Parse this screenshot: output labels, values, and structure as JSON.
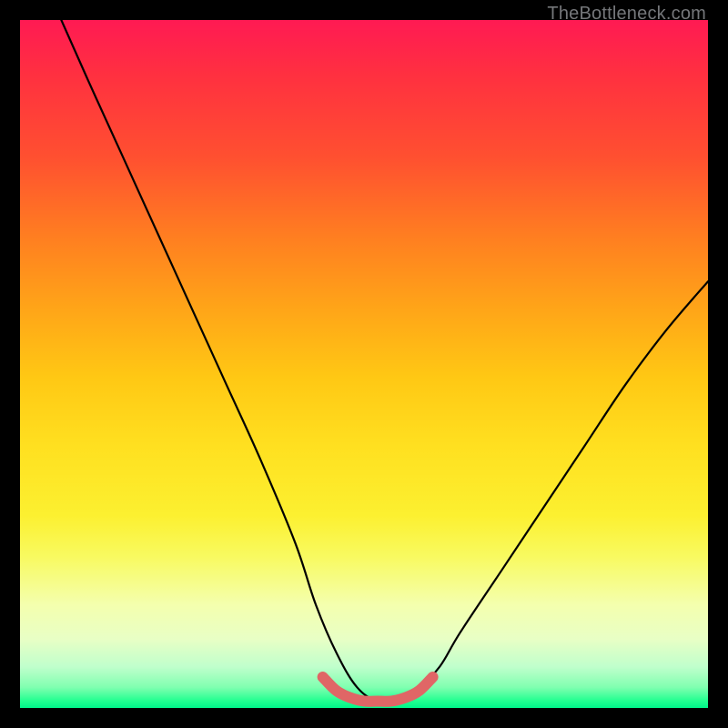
{
  "watermark": "TheBottleneck.com",
  "chart_data": {
    "type": "line",
    "title": "",
    "xlabel": "",
    "ylabel": "",
    "xlim": [
      0,
      100
    ],
    "ylim": [
      0,
      100
    ],
    "series": [
      {
        "name": "bottleneck-curve",
        "x": [
          6,
          10,
          15,
          20,
          25,
          30,
          35,
          40,
          43,
          46,
          49,
          52,
          55,
          58,
          61,
          64,
          70,
          76,
          82,
          88,
          94,
          100
        ],
        "y": [
          100,
          91,
          80,
          69,
          58,
          47,
          36,
          24,
          15,
          8,
          3,
          1,
          1,
          3,
          6,
          11,
          20,
          29,
          38,
          47,
          55,
          62
        ]
      },
      {
        "name": "valley-band",
        "x": [
          44,
          46,
          48,
          50,
          52,
          54,
          56,
          58,
          60
        ],
        "y": [
          4.5,
          2.5,
          1.5,
          1.0,
          1.0,
          1.0,
          1.5,
          2.5,
          4.5
        ]
      }
    ],
    "gradient_stops": [
      {
        "pos": 0,
        "color": "#ff1a53"
      },
      {
        "pos": 8,
        "color": "#ff3040"
      },
      {
        "pos": 20,
        "color": "#ff5030"
      },
      {
        "pos": 32,
        "color": "#ff8020"
      },
      {
        "pos": 42,
        "color": "#ffa518"
      },
      {
        "pos": 52,
        "color": "#ffc814"
      },
      {
        "pos": 62,
        "color": "#ffe020"
      },
      {
        "pos": 72,
        "color": "#fcf030"
      },
      {
        "pos": 78,
        "color": "#f8fa60"
      },
      {
        "pos": 85,
        "color": "#f4ffae"
      },
      {
        "pos": 90,
        "color": "#e8ffc5"
      },
      {
        "pos": 94,
        "color": "#c0ffcc"
      },
      {
        "pos": 97,
        "color": "#80ffb0"
      },
      {
        "pos": 99,
        "color": "#20ff90"
      },
      {
        "pos": 100,
        "color": "#00f58a"
      }
    ],
    "colors": {
      "frame": "#000000",
      "curve": "#000000",
      "band": "#e06666"
    }
  }
}
